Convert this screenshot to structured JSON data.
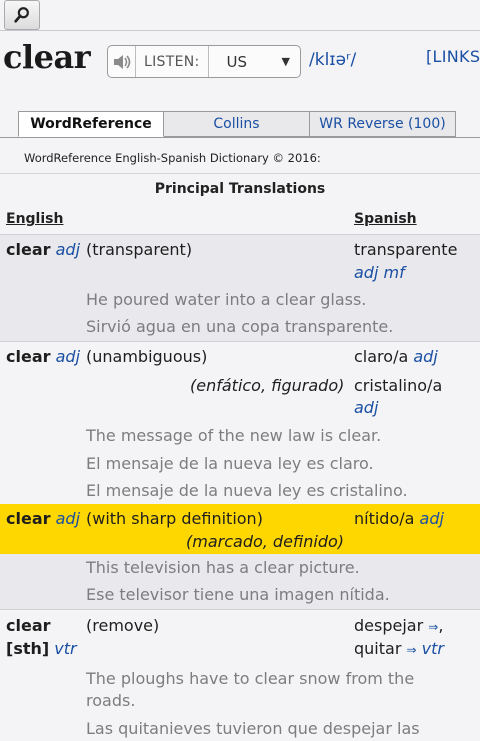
{
  "header": {
    "headword": "clear",
    "listen_label": "LISTEN:",
    "accent": "US",
    "pronunciation": "/klɪəʳ/",
    "links": "[LINKS]"
  },
  "tabs": [
    "WordReference",
    "Collins",
    "WR Reverse (100)"
  ],
  "copyright": "WordReference English-Spanish Dictionary © 2016:",
  "section_title": "Principal Translations",
  "columns": {
    "english": "English",
    "spanish": "Spanish"
  },
  "entries": [
    {
      "word": "clear",
      "pos": "adj",
      "sense": "(transparent)",
      "translation": "transparente",
      "translation_pos": "adj mf",
      "examples": [
        "He poured water into a clear glass.",
        "Sirvió agua en una copa transparente."
      ]
    },
    {
      "word": "clear",
      "pos": "adj",
      "sense": "(unambiguous)",
      "translation": "claro/a",
      "translation_pos": "adj",
      "sense2": "(enfático, figurado)",
      "translation2": "cristalino/a",
      "translation2_pos": "adj",
      "examples": [
        "The message of the new law is clear.",
        "El mensaje de la nueva ley es claro.",
        "El mensaje de la nueva ley es cristalino."
      ]
    },
    {
      "word": "clear",
      "pos": "adj",
      "sense": "(with sharp definition)",
      "translation": "nítido/a",
      "translation_pos": "adj",
      "sense2": "(marcado, definido)",
      "examples": [
        "This television has a clear picture.",
        "Ese televisor tiene una imagen nítida."
      ]
    },
    {
      "word": "clear",
      "word2": "[sth]",
      "pos": "vtr",
      "sense": "(remove)",
      "translation": "despejar",
      "translation_suffix": ",",
      "translation2": "quitar",
      "translation2_pos": "vtr",
      "examples": [
        "The ploughs have to clear snow from the",
        "roads.",
        "Las quitanieves tuvieron que despejar las"
      ]
    }
  ],
  "colors": {
    "highlight": "#ffd700",
    "link": "#1a4fa3",
    "example": "#7d7d80"
  }
}
